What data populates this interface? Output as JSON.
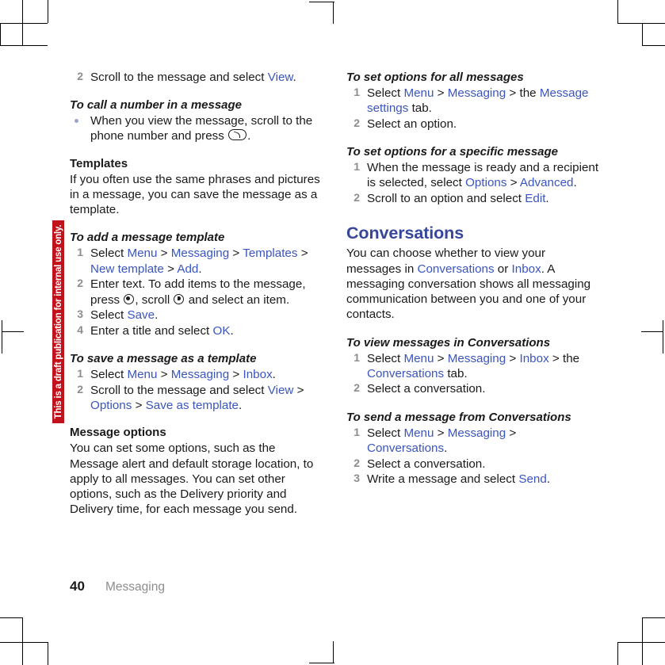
{
  "document": {
    "watermark": "This is a draft publication for internal use only.",
    "watermark_color": "#c1121c",
    "link_color": "#3a55bf",
    "heading_color": "#36469b",
    "number_color": "#8d8d8d"
  },
  "footer": {
    "page_number": "40",
    "section": "Messaging"
  },
  "left_column": {
    "step_scroll_message": {
      "number": "2",
      "text_before": "Scroll to the message and select ",
      "link": "View",
      "text_after": "."
    },
    "call_number_heading": "To call a number in a message",
    "call_number_bullet": {
      "text_before": "When you view the message, scroll to the phone number and press ",
      "icon": "call-key-icon",
      "text_after": "."
    },
    "templates_heading": "Templates",
    "templates_para": "If you often use the same phrases and pictures in a message, you can save the message as a template.",
    "add_template_heading": "To add a message template",
    "add_template_steps": [
      {
        "number": "1",
        "prefix": "Select ",
        "links": [
          "Menu",
          "Messaging",
          "Templates",
          "New template",
          "Add"
        ],
        "suffix": "."
      },
      {
        "number": "2",
        "text_a": "Enter text. To add items to the message, press ",
        "icon_a": "center-select-key-icon",
        "text_b": ", scroll ",
        "icon_b": "navigation-key-icon",
        "text_c": " and select an item."
      },
      {
        "number": "3",
        "prefix": "Select ",
        "links": [
          "Save"
        ],
        "suffix": "."
      },
      {
        "number": "4",
        "prefix": "Enter a title and select ",
        "links": [
          "OK"
        ],
        "suffix": "."
      }
    ],
    "save_template_heading": "To save a message as a template",
    "save_template_steps": [
      {
        "number": "1",
        "prefix": "Select ",
        "links": [
          "Menu",
          "Messaging",
          "Inbox"
        ],
        "suffix": "."
      },
      {
        "number": "2",
        "prefix": "Scroll to the message and select ",
        "links": [
          "View",
          "Options",
          "Save as template"
        ],
        "suffix": "."
      }
    ],
    "message_options_heading": "Message options",
    "message_options_para": "You can set some options, such as the Message alert and default storage location, to apply to all messages. You can set other options, such as the Delivery priority and Delivery time, for each message you send."
  },
  "right_column": {
    "all_messages_heading": "To set options for all messages",
    "all_messages_steps": [
      {
        "number": "1",
        "prefix": "Select ",
        "links": [
          "Menu",
          "Messaging"
        ],
        "mid": " > the ",
        "tail_link": "Message settings",
        "suffix": " tab."
      },
      {
        "number": "2",
        "prefix": "Select an option.",
        "links": [],
        "suffix": ""
      }
    ],
    "specific_message_heading": "To set options for a specific message",
    "specific_message_steps": [
      {
        "number": "1",
        "prefix": "When the message is ready and a recipient is selected, select ",
        "links": [
          "Options",
          "Advanced"
        ],
        "suffix": "."
      },
      {
        "number": "2",
        "prefix": "Scroll to an option and select ",
        "links": [
          "Edit"
        ],
        "suffix": "."
      }
    ],
    "conversations_heading": "Conversations",
    "conversations_para_a": "You can choose whether to view your messages in ",
    "conversations_para_link_a": "Conversations",
    "conversations_para_b": " or ",
    "conversations_para_link_b": "Inbox",
    "conversations_para_c": ". A messaging conversation shows all messaging communication between you and one of your contacts.",
    "view_conversations_heading": "To view messages in Conversations",
    "view_conversations_steps": [
      {
        "number": "1",
        "prefix": "Select ",
        "links": [
          "Menu",
          "Messaging",
          "Inbox"
        ],
        "mid": " > the ",
        "tail_link": "Conversations",
        "suffix": " tab."
      },
      {
        "number": "2",
        "prefix": "Select a conversation.",
        "links": [],
        "suffix": ""
      }
    ],
    "send_conversations_heading": "To send a message from Conversations",
    "send_conversations_steps": [
      {
        "number": "1",
        "prefix": "Select ",
        "links": [
          "Menu",
          "Messaging",
          "Conversations"
        ],
        "suffix": "."
      },
      {
        "number": "2",
        "prefix": "Select a conversation.",
        "links": [],
        "suffix": ""
      },
      {
        "number": "3",
        "prefix": "Write a message and select ",
        "links": [
          "Send"
        ],
        "suffix": "."
      }
    ]
  }
}
